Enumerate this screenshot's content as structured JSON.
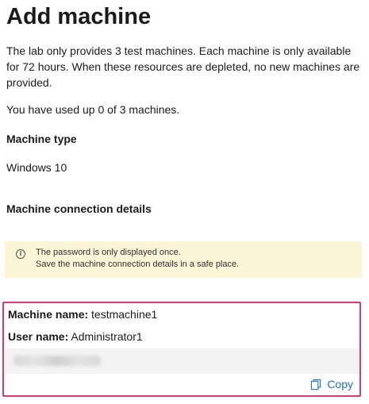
{
  "page": {
    "title": "Add machine",
    "intro": "The lab only provides 3 test machines. Each machine is only available for 72 hours. When these resources are depleted, no new machines are provided.",
    "usage": "You have used up 0 of 3 machines."
  },
  "machine_type": {
    "label": "Machine type",
    "value": "Windows 10"
  },
  "connection": {
    "label": "Machine connection details"
  },
  "warning": {
    "icon": "info-icon",
    "line1": "The password is only displayed once.",
    "line2": "Save the machine connection details in a safe place."
  },
  "details": {
    "machine_name_label": "Machine name:",
    "machine_name_value": "testmachine1",
    "user_name_label": "User name:",
    "user_name_value": "Administrator1",
    "copy_label": "Copy",
    "copy_icon": "copy-icon"
  },
  "colors": {
    "warning_background": "#fcf4d6",
    "highlight_border": "#d63a6e",
    "link": "#1f6fc6"
  }
}
